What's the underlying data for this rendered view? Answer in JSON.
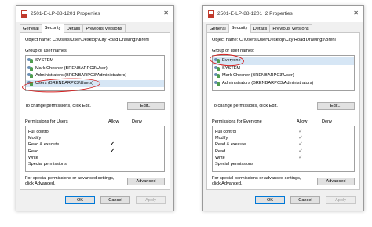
{
  "dialogs": [
    {
      "title": "2501-E-LP-88-1201 Properties",
      "tabs": [
        "General",
        "Security",
        "Details",
        "Previous Versions"
      ],
      "active_tab": "Security",
      "object_name_label": "Object name:",
      "object_name_value": "C:\\Users\\User\\Desktop\\City Road Drawings\\Brenl",
      "groups_label": "Group or user names:",
      "principals": [
        {
          "name": "SYSTEM",
          "selected": false
        },
        {
          "name": "Mark Chesner (BRENBARPC3\\User)",
          "selected": false
        },
        {
          "name": "Administrators (BRENBARPC3\\Administrators)",
          "selected": false
        },
        {
          "name": "Users (BRENBARPC3\\Users)",
          "selected": true
        }
      ],
      "change_perm_text": "To change permissions, click Edit.",
      "edit_button": "Edit...",
      "permissions_for": "Permissions for Users",
      "allow_label": "Allow",
      "deny_label": "Deny",
      "permissions": [
        {
          "name": "Full control",
          "allow": false
        },
        {
          "name": "Modify",
          "allow": false
        },
        {
          "name": "Read & execute",
          "allow": true
        },
        {
          "name": "Read",
          "allow": true
        },
        {
          "name": "Write",
          "allow": false
        },
        {
          "name": "Special permissions",
          "allow": false
        }
      ],
      "check_style": "black",
      "special_text_1": "For special permissions or advanced settings,",
      "special_text_2": "click Advanced.",
      "advanced_button": "Advanced",
      "ok_button": "OK",
      "cancel_button": "Cancel",
      "apply_button": "Apply"
    },
    {
      "title": "2501-E-LP-88-1201_2 Properties",
      "tabs": [
        "General",
        "Security",
        "Details",
        "Previous Versions"
      ],
      "active_tab": "Security",
      "object_name_label": "Object name:",
      "object_name_value": "C:\\Users\\User\\Desktop\\City Road Drawings\\Brenl",
      "groups_label": "Group or user names:",
      "principals": [
        {
          "name": "Everyone",
          "selected": true
        },
        {
          "name": "SYSTEM",
          "selected": false
        },
        {
          "name": "Mark Chesner (BRENBARPC3\\User)",
          "selected": false
        },
        {
          "name": "Administrators (BRENBARPC3\\Administrators)",
          "selected": false
        }
      ],
      "change_perm_text": "To change permissions, click Edit.",
      "edit_button": "Edit...",
      "permissions_for": "Permissions for Everyone",
      "allow_label": "Allow",
      "deny_label": "Deny",
      "permissions": [
        {
          "name": "Full control",
          "allow": true
        },
        {
          "name": "Modify",
          "allow": true
        },
        {
          "name": "Read & execute",
          "allow": true
        },
        {
          "name": "Read",
          "allow": true
        },
        {
          "name": "Write",
          "allow": true
        },
        {
          "name": "Special permissions",
          "allow": false
        }
      ],
      "check_style": "gray",
      "special_text_1": "For special permissions or advanced settings,",
      "special_text_2": "click Advanced.",
      "advanced_button": "Advanced",
      "ok_button": "OK",
      "cancel_button": "Cancel",
      "apply_button": "Apply"
    }
  ],
  "colors": {
    "annotation": "#d41f1f",
    "selection": "#d6e6f5",
    "check_gray": "#9e9e9e"
  },
  "icons": {
    "file": "pdf-file-icon",
    "principal": "user-group-icon",
    "check": "check-icon",
    "close": "close-icon"
  }
}
